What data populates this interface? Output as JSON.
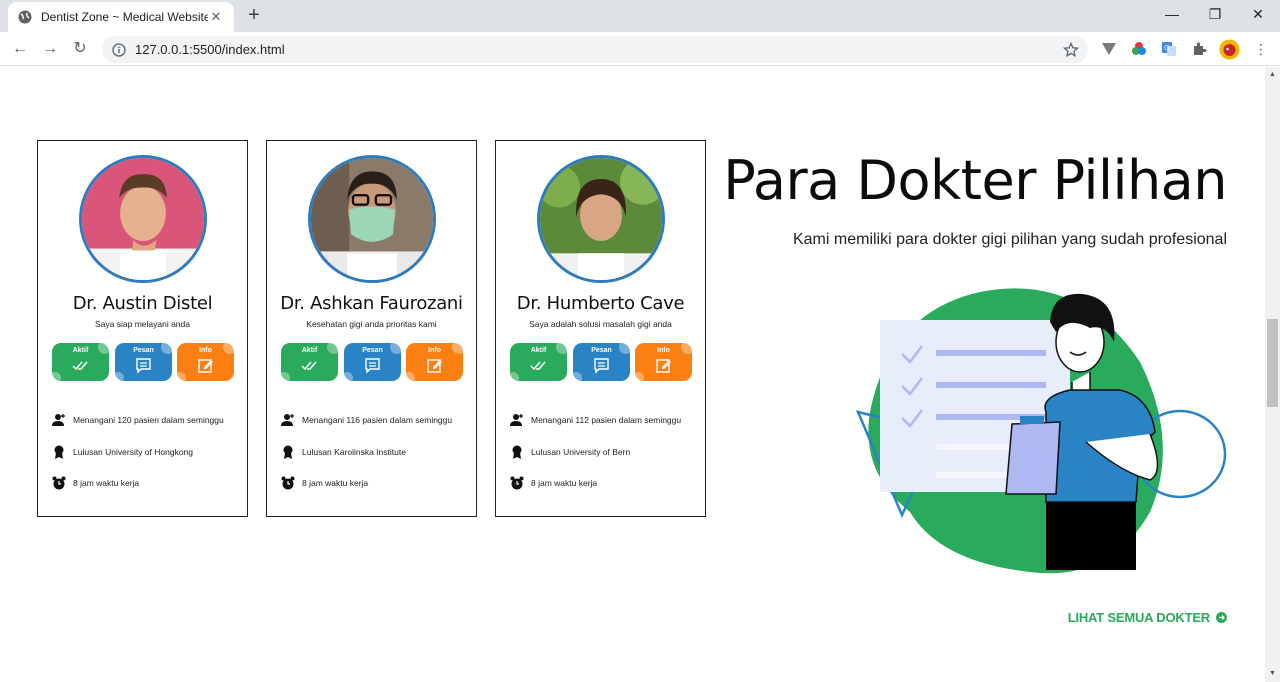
{
  "browser": {
    "tab_title": "Dentist Zone ~ Medical Website",
    "url": "127.0.0.1:5500/index.html"
  },
  "doctors": [
    {
      "name": "Dr. Austin Distel",
      "tagline": "Saya siap melayani anda",
      "actions": [
        "Aktif",
        "Pesan",
        "Info"
      ],
      "patients": "Menangani 120 pasien dalam seminggu",
      "education": "Lulusan University of Hongkong",
      "hours": "8 jam waktu kerja"
    },
    {
      "name": "Dr. Ashkan Faurozani",
      "tagline": "Kesehatan gigi anda prioritas kami",
      "actions": [
        "Aktif",
        "Pesan",
        "Info"
      ],
      "patients": "Menangani 116 pasien dalam seminggu",
      "education": "Lulusan Karolinska Institute",
      "hours": "8 jam waktu kerja"
    },
    {
      "name": "Dr. Humberto Cave",
      "tagline": "Saya adalah solusi masalah gigi anda",
      "actions": [
        "Aktif",
        "Pesan",
        "Info"
      ],
      "patients": "Menangani 112 pasien dalam seminggu",
      "education": "Lulusan University of Bern",
      "hours": "8 jam waktu kerja"
    }
  ],
  "hero": {
    "title": "Para Dokter Pilihan",
    "subtitle": "Kami memiliki para dokter gigi pilihan yang sudah profesional",
    "cta": "LIHAT SEMUA DOKTER"
  },
  "colors": {
    "green": "#2aaa5c",
    "blue": "#2a83c5",
    "orange": "#fb7f12"
  }
}
